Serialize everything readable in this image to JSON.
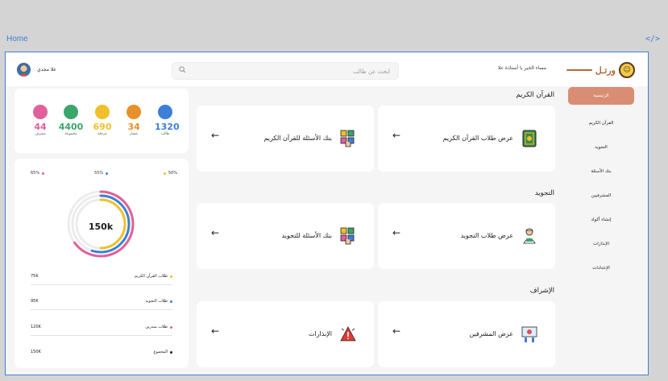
{
  "frame": {
    "label": "Home",
    "code_icon": "code-icon"
  },
  "topbar": {
    "logo_text": "ورتـل",
    "greeting": "مساء الخير يا أستاذة علا",
    "search_placeholder": "أبحث عن طالب",
    "user_name": "علا مجدي"
  },
  "sidebar": {
    "items": [
      {
        "label": "الرئيسية",
        "active": true
      },
      {
        "label": "القرآن الكريم"
      },
      {
        "label": "التجويد"
      },
      {
        "label": "بنك الأسئلة"
      },
      {
        "label": "المشرفيين"
      },
      {
        "label": "إنشاء أكواد"
      },
      {
        "label": "الإنذارات"
      },
      {
        "label": "الإعدادات"
      }
    ]
  },
  "sections": [
    {
      "title": "القرآن الكريم",
      "cards": [
        {
          "label": "عرض طلاب القرآن الكريم",
          "icon": "quran-book-icon"
        },
        {
          "label": "بنك الأسئلة للقرآن الكريم",
          "icon": "question-bank-icon"
        }
      ]
    },
    {
      "title": "التجويد",
      "cards": [
        {
          "label": "عرض طلاب التجويد",
          "icon": "reciter-icon"
        },
        {
          "label": "بنك الأسئلة للتجويد",
          "icon": "question-bank-icon"
        }
      ]
    },
    {
      "title": "الإشراف",
      "cards": [
        {
          "label": "عرض المشرفين",
          "icon": "supervisor-board-icon"
        },
        {
          "label": "الإنذارات",
          "icon": "warning-icon"
        }
      ]
    }
  ],
  "stats": [
    {
      "value": "1320",
      "caption": "طالب",
      "color": "#3d7fd6"
    },
    {
      "value": "34",
      "caption": "مسار",
      "color": "#e8902a"
    },
    {
      "value": "690",
      "caption": "مرحلة",
      "color": "#f0c02a"
    },
    {
      "value": "4400",
      "caption": "مجموعة",
      "color": "#3aa66a"
    },
    {
      "value": "44",
      "caption": "مشرف",
      "color": "#e0609a"
    }
  ],
  "donut": {
    "center": "150k",
    "percents": [
      {
        "value": "50%",
        "color": "#f0c02a"
      },
      {
        "value": "55%",
        "color": "#3d7fd6"
      },
      {
        "value": "65%",
        "color": "#e0609a"
      }
    ],
    "fill": {
      "outer": 0.65,
      "middle": 0.55,
      "inner": 0.5
    }
  },
  "breakdown": [
    {
      "value": "75K",
      "label": "طلاب القرآن الكريم",
      "color": "#f0c02a"
    },
    {
      "value": "95K",
      "label": "طلاب التجويد",
      "color": "#3d7fd6"
    },
    {
      "value": "120K",
      "label": "طلاب منذرين",
      "color": "#e0609a"
    },
    {
      "value": "150K",
      "label": "المجموع",
      "color": "#222222"
    }
  ]
}
